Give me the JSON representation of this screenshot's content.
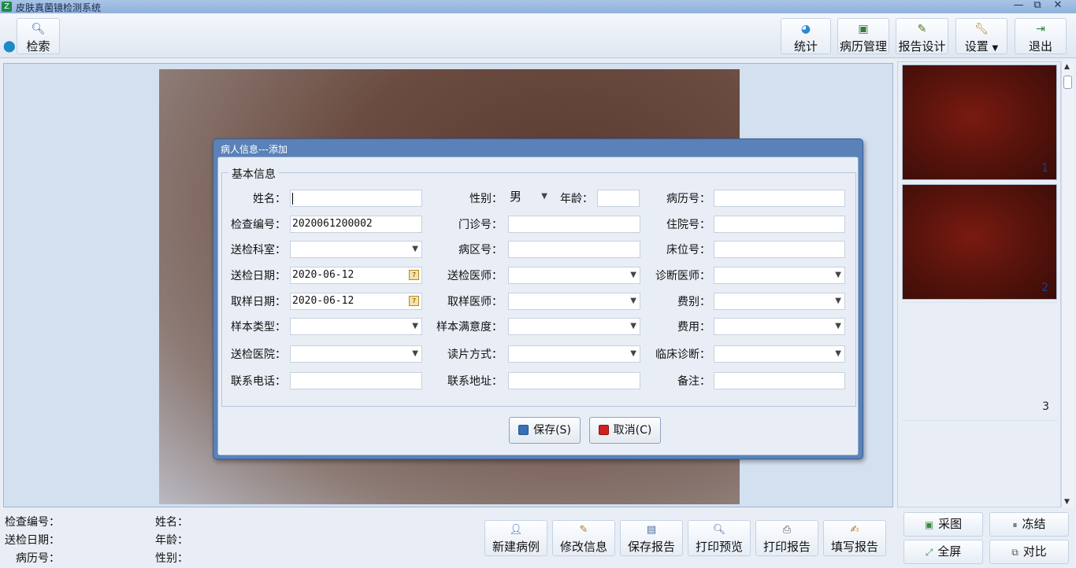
{
  "window": {
    "title": "皮肤真菌镜检测系统",
    "min": "—",
    "restore": "⧉",
    "close": "✕"
  },
  "toolbar": {
    "search": "检索",
    "stats": "统计",
    "records": "病历管理",
    "report_design": "报告设计",
    "settings": "设置",
    "exit": "退出"
  },
  "thumbs": [
    "1",
    "2",
    "3"
  ],
  "info": {
    "exam_no": "检查编号：",
    "send_date": "送检日期：",
    "record_no": "病历号：",
    "name": "姓名：",
    "age": "年龄：",
    "sex": "性别："
  },
  "bottom_buttons": {
    "new_case": "新建病例",
    "edit_info": "修改信息",
    "save_report": "保存报告",
    "print_preview": "打印预览",
    "print_report": "打印报告",
    "fill_report": "填写报告"
  },
  "side_buttons": {
    "capture": "采图",
    "freeze": "冻结",
    "fullscreen": "全屏",
    "compare": "对比"
  },
  "dialog": {
    "title": "病人信息---添加",
    "group": "基本信息",
    "labels": {
      "name": "姓名：",
      "sex": "性别：",
      "age": "年龄：",
      "record_no": "病历号：",
      "exam_no": "检查编号：",
      "outpatient_no": "门诊号：",
      "inpatient_no": "住院号：",
      "dept": "送检科室：",
      "ward_no": "病区号：",
      "bed_no": "床位号：",
      "send_date": "送检日期：",
      "send_doctor": "送检医师：",
      "diag_doctor": "诊断医师：",
      "sample_date": "取样日期：",
      "sample_doctor": "取样医师：",
      "fee_type": "费别：",
      "sample_type": "样本类型：",
      "sample_satisfaction": "样本满意度：",
      "fee": "费用：",
      "hospital": "送检医院：",
      "reading_mode": "读片方式：",
      "clinical_diag": "临床诊断：",
      "phone": "联系电话：",
      "address": "联系地址：",
      "remark": "备注："
    },
    "values": {
      "sex": "男",
      "exam_no": "2020061200002",
      "send_date": "2020-06-12",
      "sample_date": "2020-06-12"
    },
    "save": "保存(S)",
    "cancel": "取消(C)"
  }
}
